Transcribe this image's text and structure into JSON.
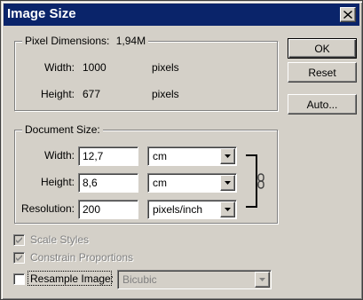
{
  "dialog": {
    "title": "Image Size",
    "close_icon": "close-icon"
  },
  "buttons": {
    "ok": "OK",
    "reset": "Reset",
    "auto": "Auto..."
  },
  "pixel_dimensions": {
    "legend": "Pixel Dimensions:",
    "size": "1,94M",
    "width_label": "Width:",
    "width_value": "1000",
    "width_unit": "pixels",
    "height_label": "Height:",
    "height_value": "677",
    "height_unit": "pixels"
  },
  "document_size": {
    "legend": "Document Size:",
    "width_label": "Width:",
    "width_value": "12,7",
    "width_unit": "cm",
    "height_label": "Height:",
    "height_value": "8,6",
    "height_unit": "cm",
    "resolution_label": "Resolution:",
    "resolution_value": "200",
    "resolution_unit": "pixels/inch",
    "link_icon": "chain-link-icon"
  },
  "options": {
    "scale_styles": {
      "label": "Scale Styles",
      "checked": true,
      "enabled": false
    },
    "constrain_proportions": {
      "label": "Constrain Proportions",
      "checked": true,
      "enabled": false
    },
    "resample_image": {
      "label": "Resample Image:",
      "checked": false,
      "enabled": true
    },
    "resample_method": "Bicubic"
  }
}
